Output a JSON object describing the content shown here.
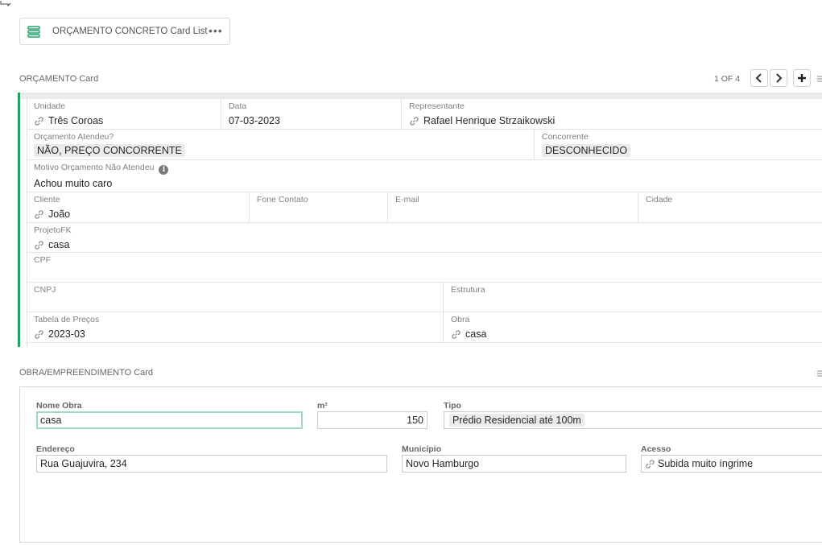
{
  "widget": {
    "title": "ORÇAMENTO CONCRETO Card List",
    "menu_icon": "ellipsis-icon",
    "list_icon": "card-list-icon"
  },
  "card1": {
    "title": "ORÇAMENTO Card",
    "pager": "1 OF 4",
    "unidade": {
      "label": "Unidade",
      "value": "Três Coroas"
    },
    "data": {
      "label": "Data",
      "value": "07-03-2023"
    },
    "representante": {
      "label": "Representante",
      "value": "Rafael Henrique Strzaikowski"
    },
    "atendeu": {
      "label": "Orçamento Atendeu?",
      "value": "NÃO, PREÇO CONCORRENTE"
    },
    "concorrente": {
      "label": "Concorrente",
      "value": "DESCONHECIDO"
    },
    "motivo": {
      "label": "Motivo Orçamento Não Atendeu",
      "value": "Achou muito caro"
    },
    "cliente": {
      "label": "Cliente",
      "value": "João"
    },
    "fone": {
      "label": "Fone Contato",
      "value": ""
    },
    "email": {
      "label": "E-mail",
      "value": ""
    },
    "cidade": {
      "label": "Cidade",
      "value": ""
    },
    "projeto": {
      "label": "ProjetoFK",
      "value": "casa"
    },
    "cpf": {
      "label": "CPF",
      "value": ""
    },
    "cnpj": {
      "label": "CNPJ",
      "value": ""
    },
    "estrutura": {
      "label": "Estrutura",
      "value": ""
    },
    "tabela": {
      "label": "Tabela de Preços",
      "value": "2023-03"
    },
    "obra": {
      "label": "Obra",
      "value": "casa"
    }
  },
  "card2": {
    "title": "OBRA/EMPREENDIMENTO Card",
    "nome_obra": {
      "label": "Nome Obra",
      "value": "casa"
    },
    "m2": {
      "label": "m²",
      "value": "150"
    },
    "tipo": {
      "label": "Tipo",
      "value": "Prédio Residencial até 100m"
    },
    "endereco": {
      "label": "Endereço",
      "value": "Rua Guajuvira, 234"
    },
    "municipio": {
      "label": "Município",
      "value": "Novo Hamburgo"
    },
    "acesso": {
      "label": "Acesso",
      "value": "Subida muito íngrime"
    }
  },
  "colors": {
    "accent": "#21a366",
    "focus_border": "#9fd8c3"
  }
}
